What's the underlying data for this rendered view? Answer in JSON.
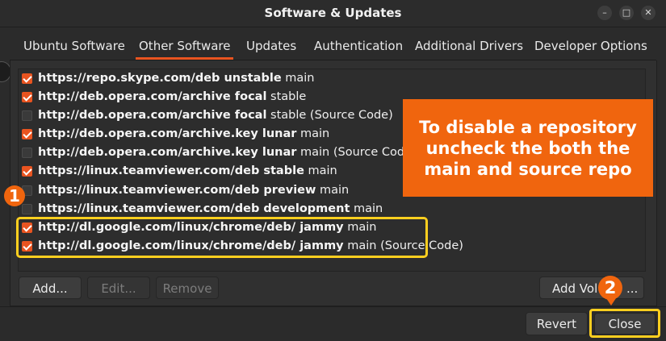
{
  "window": {
    "title": "Software & Updates",
    "minimize_icon": "minimize-icon",
    "maximize_icon": "maximize-icon",
    "close_icon": "close-icon"
  },
  "tabs": [
    {
      "label": "Ubuntu Software"
    },
    {
      "label": "Other Software",
      "active": true
    },
    {
      "label": "Updates"
    },
    {
      "label": "Authentication"
    },
    {
      "label": "Additional Drivers"
    },
    {
      "label": "Developer Options"
    }
  ],
  "sources": [
    {
      "checked": true,
      "url": "https://repo.skype.com/deb unstable",
      "suffix": " main"
    },
    {
      "checked": true,
      "url": "http://deb.opera.com/archive focal",
      "suffix": " stable"
    },
    {
      "checked": false,
      "url": "http://deb.opera.com/archive focal",
      "suffix": " stable (Source Code)"
    },
    {
      "checked": true,
      "url": "http://deb.opera.com/archive.key lunar",
      "suffix": " main"
    },
    {
      "checked": false,
      "url": "http://deb.opera.com/archive.key lunar",
      "suffix": " main (Source Code)"
    },
    {
      "checked": true,
      "url": "https://linux.teamviewer.com/deb stable",
      "suffix": " main"
    },
    {
      "checked": false,
      "url": "https://linux.teamviewer.com/deb preview",
      "suffix": " main"
    },
    {
      "checked": false,
      "url": "https://linux.teamviewer.com/deb development",
      "suffix": " main"
    },
    {
      "checked": true,
      "url": "http://dl.google.com/linux/chrome/deb/ jammy",
      "suffix": " main"
    },
    {
      "checked": true,
      "url": "http://dl.google.com/linux/chrome/deb/ jammy",
      "suffix": " main (Source Code)"
    }
  ],
  "buttons": {
    "add": "Add...",
    "edit": "Edit...",
    "remove": "Remove",
    "add_volume": "Add Vol",
    "add_volume_tail": "..."
  },
  "footer": {
    "revert": "Revert",
    "close": "Close"
  },
  "annotations": {
    "callout": "To disable a repository uncheck the both the main and source repo",
    "badge1": "1",
    "badge2": "2",
    "accent": "#f0650e",
    "highlight": "#ffcf1f"
  }
}
